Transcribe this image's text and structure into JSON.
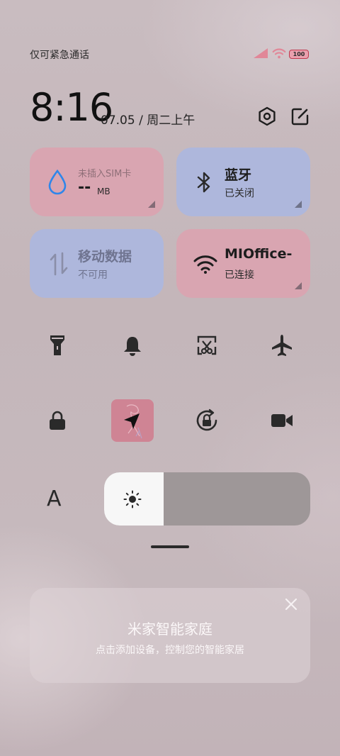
{
  "status_bar": {
    "carrier_text": "仅可紧急通话",
    "battery": "100"
  },
  "header": {
    "time": "8:16",
    "date": "07.05 / 周二上午",
    "settings_icon": "gear-hex-icon",
    "edit_icon": "edit-icon"
  },
  "tiles": [
    {
      "title": "未插入SIM卡",
      "value": "--",
      "unit": "MB",
      "icon": "water-drop-icon"
    },
    {
      "title": "蓝牙",
      "subtitle": "已关闭",
      "icon": "bluetooth-icon"
    },
    {
      "title": "移动数据",
      "subtitle": "不可用",
      "icon": "data-arrows-icon"
    },
    {
      "title": "MIOffice-",
      "subtitle": "已连接",
      "icon": "wifi-icon"
    }
  ],
  "toggles_row1": [
    "flashlight-icon",
    "bell-icon",
    "screenshot-icon",
    "airplane-icon"
  ],
  "toggles_row2": [
    "lock-icon",
    "location-icon",
    "rotation-lock-icon",
    "video-icon"
  ],
  "brightness": {
    "level": 0.29,
    "icon": "sun-icon",
    "font_icon": "A"
  },
  "card": {
    "title": "米家智能家庭",
    "subtitle": "点击添加设备，控制您的智能家居"
  },
  "colors": {
    "pink_tile": "#d9a5b1",
    "blue_tile": "#aeb7dc",
    "active_toggle": "#cf8494"
  }
}
